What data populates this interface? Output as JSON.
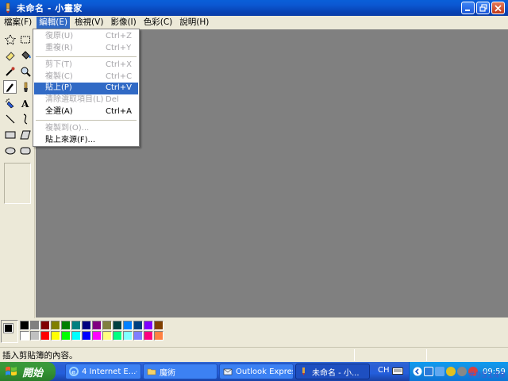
{
  "window": {
    "title": "未命名 - 小畫家"
  },
  "menubar": [
    {
      "label": "檔案(F)"
    },
    {
      "label": "編輯(E)"
    },
    {
      "label": "檢視(V)"
    },
    {
      "label": "影像(I)"
    },
    {
      "label": "色彩(C)"
    },
    {
      "label": "說明(H)"
    }
  ],
  "edit_menu": {
    "items": [
      {
        "label": "復原(U)",
        "shortcut": "Ctrl+Z"
      },
      {
        "label": "重複(R)",
        "shortcut": "Ctrl+Y"
      },
      {
        "label": "剪下(T)",
        "shortcut": "Ctrl+X"
      },
      {
        "label": "複製(C)",
        "shortcut": "Ctrl+C"
      },
      {
        "label": "貼上(P)",
        "shortcut": "Ctrl+V"
      },
      {
        "label": "清除選取項目(L)",
        "shortcut": "Del"
      },
      {
        "label": "全選(A)",
        "shortcut": "Ctrl+A"
      },
      {
        "label": "複製到(O)...",
        "shortcut": ""
      },
      {
        "label": "貼上來源(F)...",
        "shortcut": ""
      }
    ]
  },
  "toolbox": {
    "tools": [
      "free-form-select",
      "rect-select",
      "eraser",
      "fill",
      "pick-color",
      "magnifier",
      "pencil",
      "brush",
      "airbrush",
      "text",
      "line",
      "curve",
      "rectangle",
      "polygon",
      "ellipse",
      "rounded-rectangle"
    ],
    "selected": "pencil"
  },
  "palette": {
    "foreground": "#000000",
    "background": "#ffffff",
    "colors": [
      "#000000",
      "#808080",
      "#800000",
      "#808000",
      "#008000",
      "#008080",
      "#000080",
      "#800080",
      "#808040",
      "#004040",
      "#0080ff",
      "#004080",
      "#8000ff",
      "#804000",
      "#ffffff",
      "#c0c0c0",
      "#ff0000",
      "#ffff00",
      "#00ff00",
      "#00ffff",
      "#0000ff",
      "#ff00ff",
      "#ffff80",
      "#00ff80",
      "#80ffff",
      "#8080ff",
      "#ff0080",
      "#ff8040"
    ]
  },
  "status": {
    "text": "插入剪貼簿的內容。"
  },
  "taskbar": {
    "start_label": "開始",
    "tasks": [
      {
        "label": "4 Internet E..."
      },
      {
        "label": "魔術"
      },
      {
        "label": "Outlook Express"
      },
      {
        "label": "未命名 - 小..."
      }
    ],
    "language": "CH",
    "clock": "09:59"
  },
  "watermark": "#95149"
}
